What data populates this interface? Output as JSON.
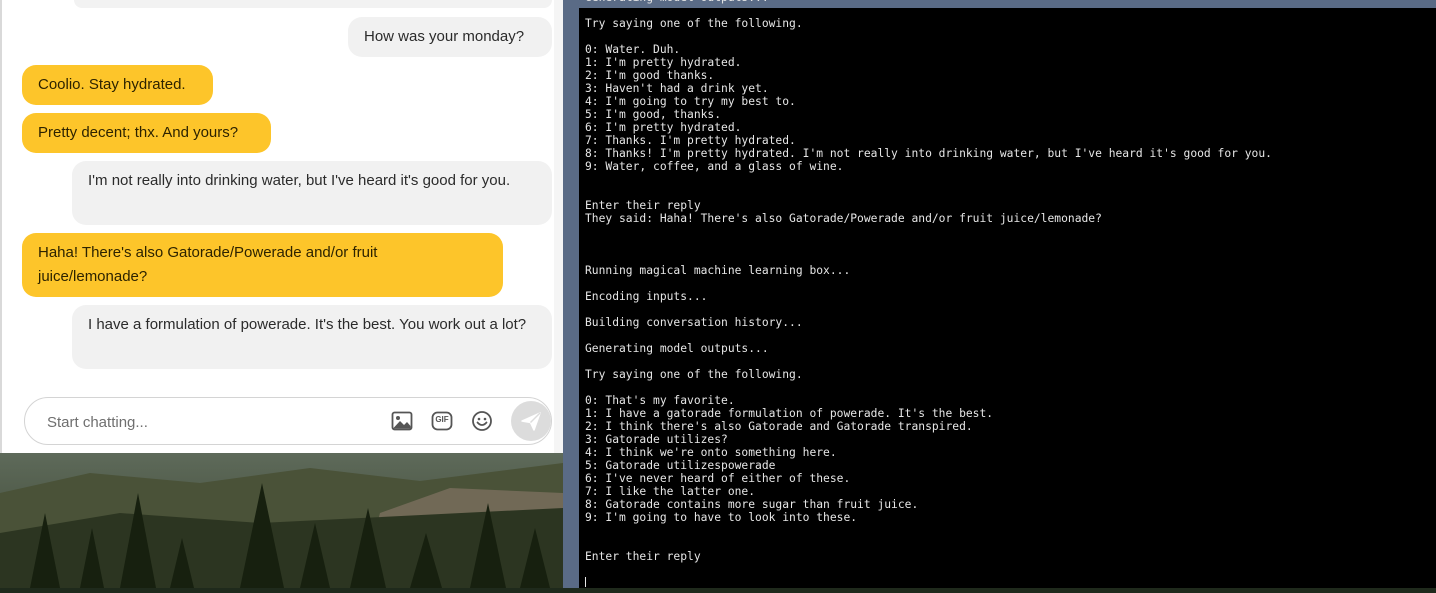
{
  "chat": {
    "messages": [
      {
        "role": "user",
        "text": "How was your monday?"
      },
      {
        "role": "bot",
        "text": "Coolio. Stay hydrated."
      },
      {
        "role": "bot",
        "text": "Pretty decent; thx. And yours?"
      },
      {
        "role": "user",
        "text": "I'm not really into drinking water, but I've heard it's good for you."
      },
      {
        "role": "bot",
        "text": "Haha! There's also Gatorade/Powerade and/or fruit juice/lemonade?"
      },
      {
        "role": "user",
        "text": "I have a formulation of powerade. It's the best. You work out a lot?"
      }
    ],
    "input": {
      "placeholder": "Start chatting...",
      "value": ""
    },
    "gif_label": "GIF",
    "colors": {
      "bot_bubble": "#fdc52a",
      "user_bubble": "#f1f1f1"
    },
    "icons": [
      "image-icon",
      "gif-icon",
      "emoji-icon",
      "send-icon"
    ]
  },
  "console": {
    "lines": [
      "Generating model outputs...",
      "",
      "Try saying one of the following.",
      "",
      "0: Water. Duh.",
      "1: I'm pretty hydrated.",
      "2: I'm good thanks.",
      "3: Haven't had a drink yet.",
      "4: I'm going to try my best to.",
      "5: I'm good, thanks.",
      "6: I'm pretty hydrated.",
      "7: Thanks. I'm pretty hydrated.",
      "8: Thanks! I'm pretty hydrated. I'm not really into drinking water, but I've heard it's good for you.",
      "9: Water, coffee, and a glass of wine.",
      "",
      "",
      "Enter their reply",
      "They said: Haha! There's also Gatorade/Powerade and/or fruit juice/lemonade?",
      "",
      "",
      "",
      "Running magical machine learning box...",
      "",
      "Encoding inputs...",
      "",
      "Building conversation history...",
      "",
      "Generating model outputs...",
      "",
      "Try saying one of the following.",
      "",
      "0: That's my favorite.",
      "1: I have a gatorade formulation of powerade. It's the best.",
      "2: I think there's also Gatorade and Gatorade transpired.",
      "3: Gatorade utilizes?",
      "4: I think we're onto something here.",
      "5: Gatorade utilizespowerade",
      "6: I've never heard of either of these.",
      "7: I like the latter one.",
      "8: Gatorade contains more sugar than fruit juice.",
      "9: I'm going to have to look into these.",
      "",
      "",
      "Enter their reply"
    ]
  }
}
